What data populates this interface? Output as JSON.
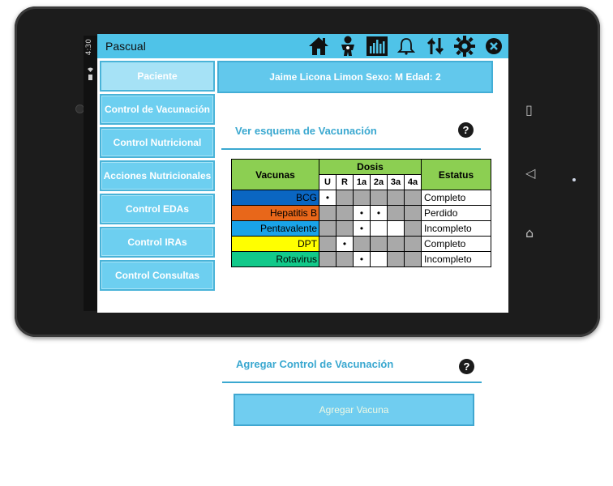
{
  "statusbar": {
    "time": "4:30"
  },
  "appbar": {
    "title": "Pascual",
    "icons": [
      "home-icon",
      "baby-icon",
      "chart-icon",
      "bell-icon",
      "sync-icon",
      "settings-icon",
      "close-icon"
    ]
  },
  "sidebar": {
    "items": [
      {
        "label": "Paciente"
      },
      {
        "label": "Control de Vacunación"
      },
      {
        "label": "Control Nutricional"
      },
      {
        "label": "Acciones Nutricionales"
      },
      {
        "label": "Control EDAs"
      },
      {
        "label": "Control IRAs"
      },
      {
        "label": "Control Consultas"
      }
    ]
  },
  "patient": {
    "summary": "Jaime Licona Limon Sexo: M Edad: 2"
  },
  "schedule": {
    "title": "Ver esquema de Vacunación",
    "help": "?",
    "headers": {
      "vaccines": "Vacunas",
      "doses": "Dosis",
      "status": "Estatus"
    },
    "dose_columns": [
      "U",
      "R",
      "1a",
      "2a",
      "3a",
      "4a"
    ],
    "rows": [
      {
        "name": "BCG",
        "color": "#0a66c2",
        "doses": [
          "•",
          "",
          "",
          "",
          "",
          ""
        ],
        "status": "Completo"
      },
      {
        "name": "Hepatitis B",
        "color": "#e8671a",
        "doses": [
          "",
          "",
          "•",
          "•",
          "",
          ""
        ],
        "status": "Perdido"
      },
      {
        "name": "Pentavalente",
        "color": "#1aa3e8",
        "doses": [
          "",
          "",
          "•",
          "",
          "",
          ""
        ],
        "status": "Incompleto"
      },
      {
        "name": "DPT",
        "color": "#ffff00",
        "doses": [
          "",
          "•",
          "",
          "",
          "",
          ""
        ],
        "status": "Completo"
      },
      {
        "name": "Rotavirus",
        "color": "#12c98a",
        "doses": [
          "",
          "",
          "•",
          "",
          "",
          ""
        ],
        "status": "Incompleto"
      }
    ]
  },
  "add_control": {
    "title": "Agregar Control de Vacunación",
    "help": "?",
    "button_label": "Agregar Vacuna"
  },
  "colors": {
    "accent": "#4fc3e8",
    "header_green": "#8ccf52",
    "title_blue": "#3aa8d0"
  }
}
